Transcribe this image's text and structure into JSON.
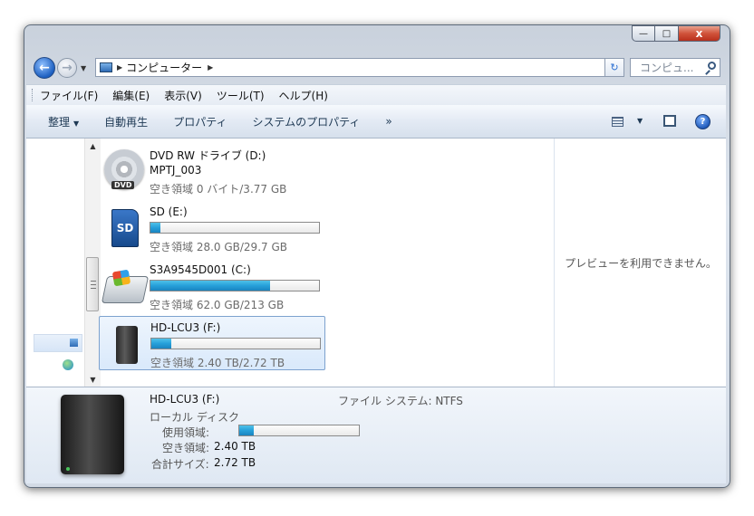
{
  "window": {
    "min": "—",
    "max": "□",
    "close": "x"
  },
  "address": {
    "crumb": "コンピューター",
    "search_placeholder": "コンピュ..."
  },
  "menu": [
    "ファイル(F)",
    "編集(E)",
    "表示(V)",
    "ツール(T)",
    "ヘルプ(H)"
  ],
  "toolbar": {
    "organize": "整理",
    "autoplay": "自動再生",
    "properties": "プロパティ",
    "system_properties": "システムのプロパティ",
    "more": "»",
    "help": "?"
  },
  "drives": [
    {
      "name": "DVD RW ドライブ (D:)",
      "label": "MPTJ_003",
      "free": "空き領域 0 バイト/3.77 GB",
      "used_fraction": null,
      "icon": "dvd-drive-icon",
      "badge": "DVD"
    },
    {
      "name": "SD (E:)",
      "free": "空き領域 28.0 GB/29.7 GB",
      "used_fraction": 0.06,
      "icon": "sd-card-icon",
      "badge": "SD"
    },
    {
      "name": "S3A9545D001 (C:)",
      "free": "空き領域 62.0 GB/213 GB",
      "used_fraction": 0.71,
      "icon": "windows-hdd-icon"
    },
    {
      "name": "HD-LCU3 (F:)",
      "free": "空き領域 2.40 TB/2.72 TB",
      "used_fraction": 0.12,
      "icon": "external-hdd-icon",
      "selected": true
    }
  ],
  "preview": {
    "message": "プレビューを利用できません。"
  },
  "details": {
    "name": "HD-LCU3 (F:)",
    "type": "ローカル ディスク",
    "filesystem": "ファイル システム: NTFS",
    "used_label": "使用領域:",
    "used_fraction": 0.12,
    "free_label": "空き領域:",
    "free_value": "2.40 TB",
    "total_label": "合計サイズ:",
    "total_value": "2.72 TB"
  }
}
